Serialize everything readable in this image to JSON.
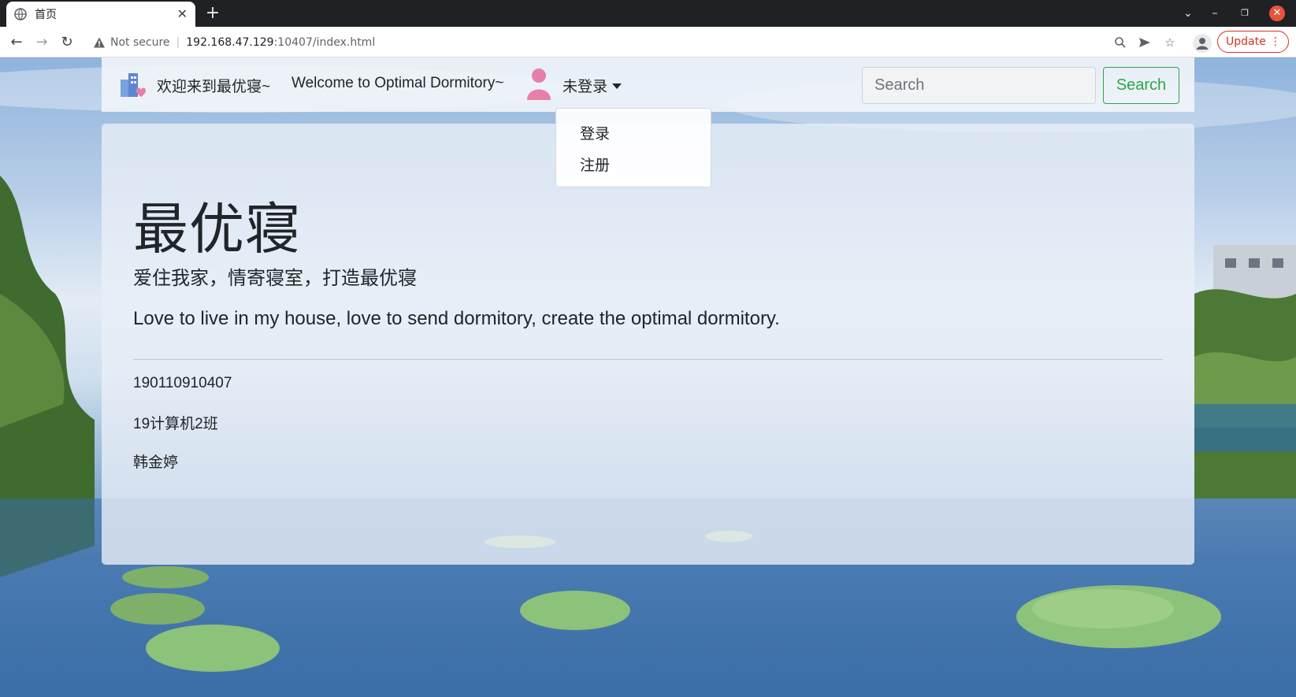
{
  "browser": {
    "tab_title": "首页",
    "new_tab": "+",
    "security_label": "Not secure",
    "url_host": "192.168.47.129",
    "url_path": ":10407/index.html",
    "update_label": "Update",
    "window_controls": {
      "list": "⌄",
      "minimize": "–",
      "restore": "❐",
      "close": "✕"
    }
  },
  "navbar": {
    "brand_cn": "欢迎来到最优寝~",
    "brand_en": "Welcome to Optimal Dormitory~",
    "user_menu_label": "未登录",
    "search_placeholder": "Search",
    "search_button": "Search"
  },
  "dropdown": {
    "items": [
      {
        "label": "登录"
      },
      {
        "label": "注册"
      }
    ]
  },
  "jumbotron": {
    "title": "最优寝",
    "subtitle_cn": "爱住我家，情寄寝室，打造最优寝",
    "subtitle_en": "Love to live in my house, love to send dormitory, create the optimal dormitory.",
    "student_id": "190110910407",
    "class_name": "19计算机2班",
    "student_name": "韩金婷"
  },
  "colors": {
    "accent_green": "#28a745",
    "update_red": "#d93025",
    "user_icon_pink": "#e680a8",
    "brand_icon_blue": "#6c8fd6"
  }
}
